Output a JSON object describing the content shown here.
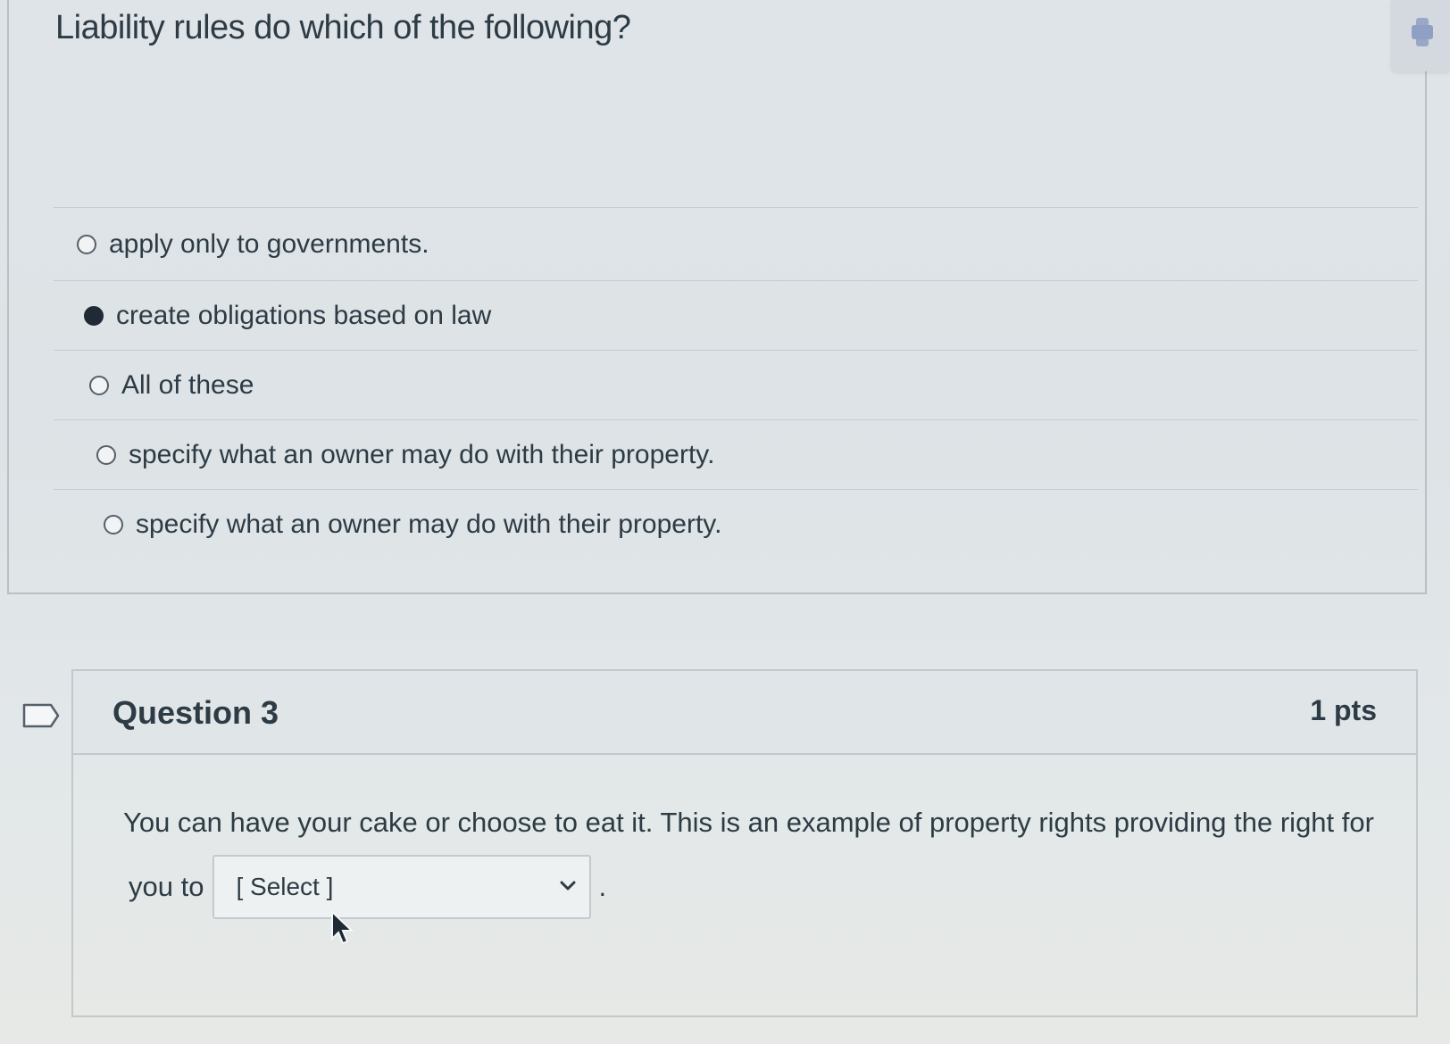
{
  "question2": {
    "text": "Liability rules do which of the following?",
    "answers": [
      {
        "label": "apply only to governments.",
        "selected": false
      },
      {
        "label": "create obligations based on law",
        "selected": true
      },
      {
        "label": "All of these",
        "selected": false
      },
      {
        "label": "specify what an owner may do with their property.",
        "selected": false
      },
      {
        "label": "specify what an owner may do with their property.",
        "selected": false
      }
    ]
  },
  "question3": {
    "title": "Question 3",
    "points": "1 pts",
    "text": "You can have your cake or choose to eat it.  This is an example of property rights providing the right for",
    "text_line2": "you to",
    "select_value": "[ Select ]",
    "trailing": "."
  },
  "colors": {
    "text": "#2d3b45",
    "border": "#c2c8cc",
    "radio_selected": "#1f2a34"
  }
}
